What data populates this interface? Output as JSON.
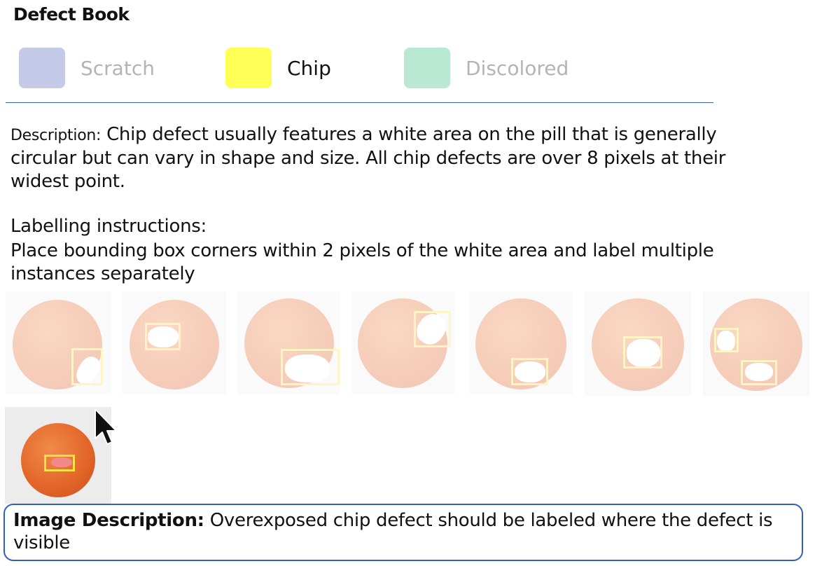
{
  "title": "Defect Book",
  "legend": [
    {
      "label": "Scratch",
      "color": "#c5cae9",
      "active": false
    },
    {
      "label": "Chip",
      "color": "#ffff55",
      "active": true
    },
    {
      "label": "Discolored",
      "color": "#b9e8d3",
      "active": false
    }
  ],
  "description": {
    "label": "Description:",
    "text": "Chip defect usually features a white area on the pill that is generally circular but can vary in shape and size. All chip defects are over 8 pixels at their widest point."
  },
  "instructions": {
    "title": "Labelling instructions:",
    "text": "Place bounding box corners within 2 pixels of the white area and label multiple instances separately"
  },
  "colors": {
    "pill": "#e4672a",
    "bbox": "#ffe24a",
    "divider": "#3a62b8",
    "highlight_border": "#2f5fbf"
  },
  "thumbnails": [
    {
      "id": "example-1",
      "selected": false
    },
    {
      "id": "example-2",
      "selected": false
    },
    {
      "id": "example-3",
      "selected": false
    },
    {
      "id": "example-4",
      "selected": false
    },
    {
      "id": "example-5",
      "selected": false
    },
    {
      "id": "example-6",
      "selected": false
    },
    {
      "id": "example-7",
      "selected": false
    },
    {
      "id": "example-8",
      "selected": true
    }
  ],
  "image_description": {
    "label": "Image Description:",
    "text": "Overexposed chip defect should be labeled where the defect is visible"
  }
}
